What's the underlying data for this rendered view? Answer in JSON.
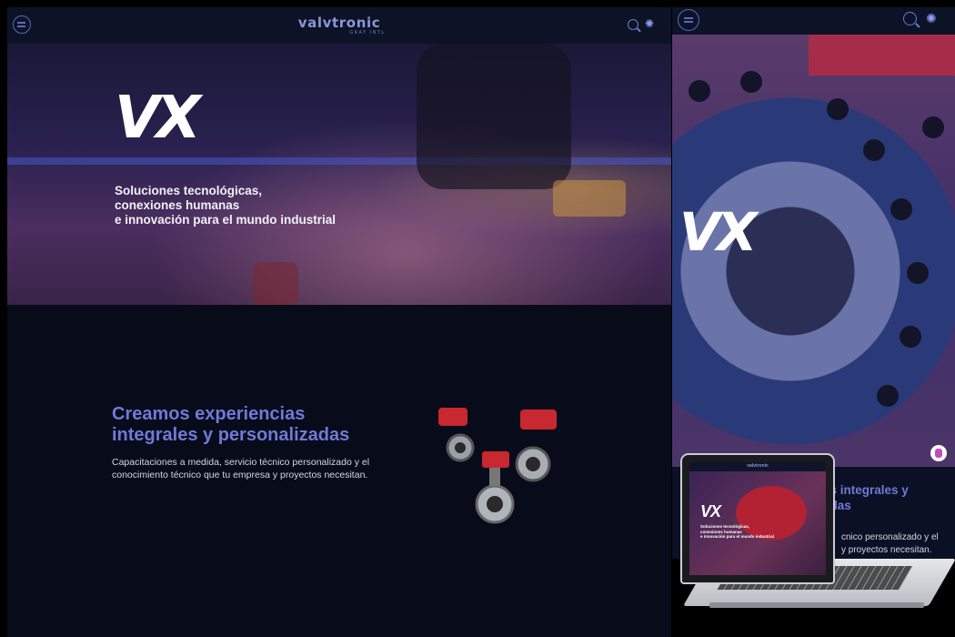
{
  "desktop": {
    "header": {
      "brand_name": "valvtronic",
      "brand_sub": "GRAY INTL",
      "menu_icon": "menu-icon",
      "search_icon": "search-icon",
      "theme_icon": "sun-icon"
    },
    "hero": {
      "logo": "VX",
      "tagline": [
        "Soluciones tecnológicas,",
        "conexiones humanas",
        "e innovación para el mundo industrial"
      ]
    },
    "section": {
      "heading": [
        "Creamos experiencias",
        "integrales y personalizadas"
      ],
      "body": "Capacitaciones a medida, servicio técnico personalizado y el conocimiento técnico que tu empresa y proyectos necesitan.",
      "image": "industrial-valves-image"
    }
  },
  "mobile": {
    "header": {
      "menu_icon": "menu-icon",
      "search_icon": "search-icon",
      "theme_icon": "sun-icon"
    },
    "hero": {
      "logo": "VX",
      "chat_icon": "chat-badge-icon"
    },
    "section": {
      "heading": [
        "as integrales y",
        "adas"
      ],
      "body": [
        "cnico personalizado y el",
        "y proyectos necesitan."
      ]
    }
  },
  "laptop": {
    "screen_brand": "valvtronic",
    "screen_logo": "VX",
    "screen_tagline": [
      "Soluciones tecnológicas,",
      "conexiones humanas",
      "e innovación para el mundo industrial"
    ]
  },
  "colors": {
    "accent": "#6f7ad8",
    "background": "#080b1a",
    "header": "#0d1326"
  }
}
